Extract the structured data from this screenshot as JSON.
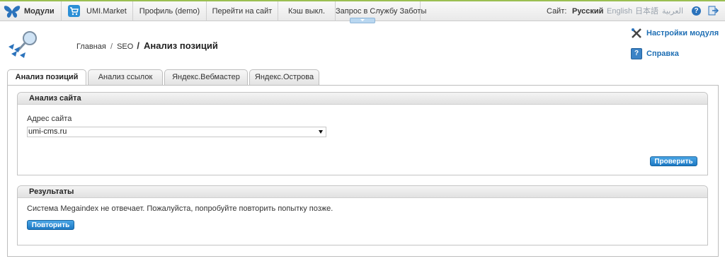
{
  "topbar": {
    "modules_label": "Модули",
    "market_label": "UMI.Market",
    "profile_label": "Профиль (demo)",
    "goto_site_label": "Перейти на сайт",
    "cache_label": "Кэш выкл.",
    "support_label": "Запрос в Службу Заботы",
    "site_label": "Сайт:",
    "languages": [
      "Русский",
      "English",
      "日本語",
      "العربية"
    ],
    "help_glyph": "?"
  },
  "header": {
    "breadcrumb": [
      "Главная",
      "SEO"
    ],
    "breadcrumb_sep": "/",
    "page_title": "Анализ позиций",
    "module_settings_label": "Настройки модуля",
    "help_label": "Справка",
    "help_glyph": "?"
  },
  "tabs": [
    {
      "label": "Анализ позиций",
      "active": true
    },
    {
      "label": "Анализ ссылок",
      "active": false
    },
    {
      "label": "Яндекс.Вебмастер",
      "active": false
    },
    {
      "label": "Яндекс.Острова",
      "active": false
    }
  ],
  "site_analysis": {
    "title": "Анализ сайта",
    "address_label": "Адрес сайта",
    "address_value": "umi-cms.ru",
    "check_button": "Проверить"
  },
  "results": {
    "title": "Результаты",
    "message": "Система Megaindex не отвечает. Пожалуйста, попробуйте повторить попытку позже.",
    "retry_button": "Повторить"
  },
  "icons": {
    "modules": "butterfly-icon",
    "market": "cart-icon",
    "support_dropdown": "chevron-down-icon",
    "help": "help-icon",
    "exit": "exit-icon",
    "logo": "seo-logo-icon",
    "settings": "tools-icon",
    "manual": "help-book-icon"
  },
  "colors": {
    "accent": "#1f6fb4",
    "button": "#2b8fd6",
    "topbar_stripe": "#9bbf52"
  }
}
